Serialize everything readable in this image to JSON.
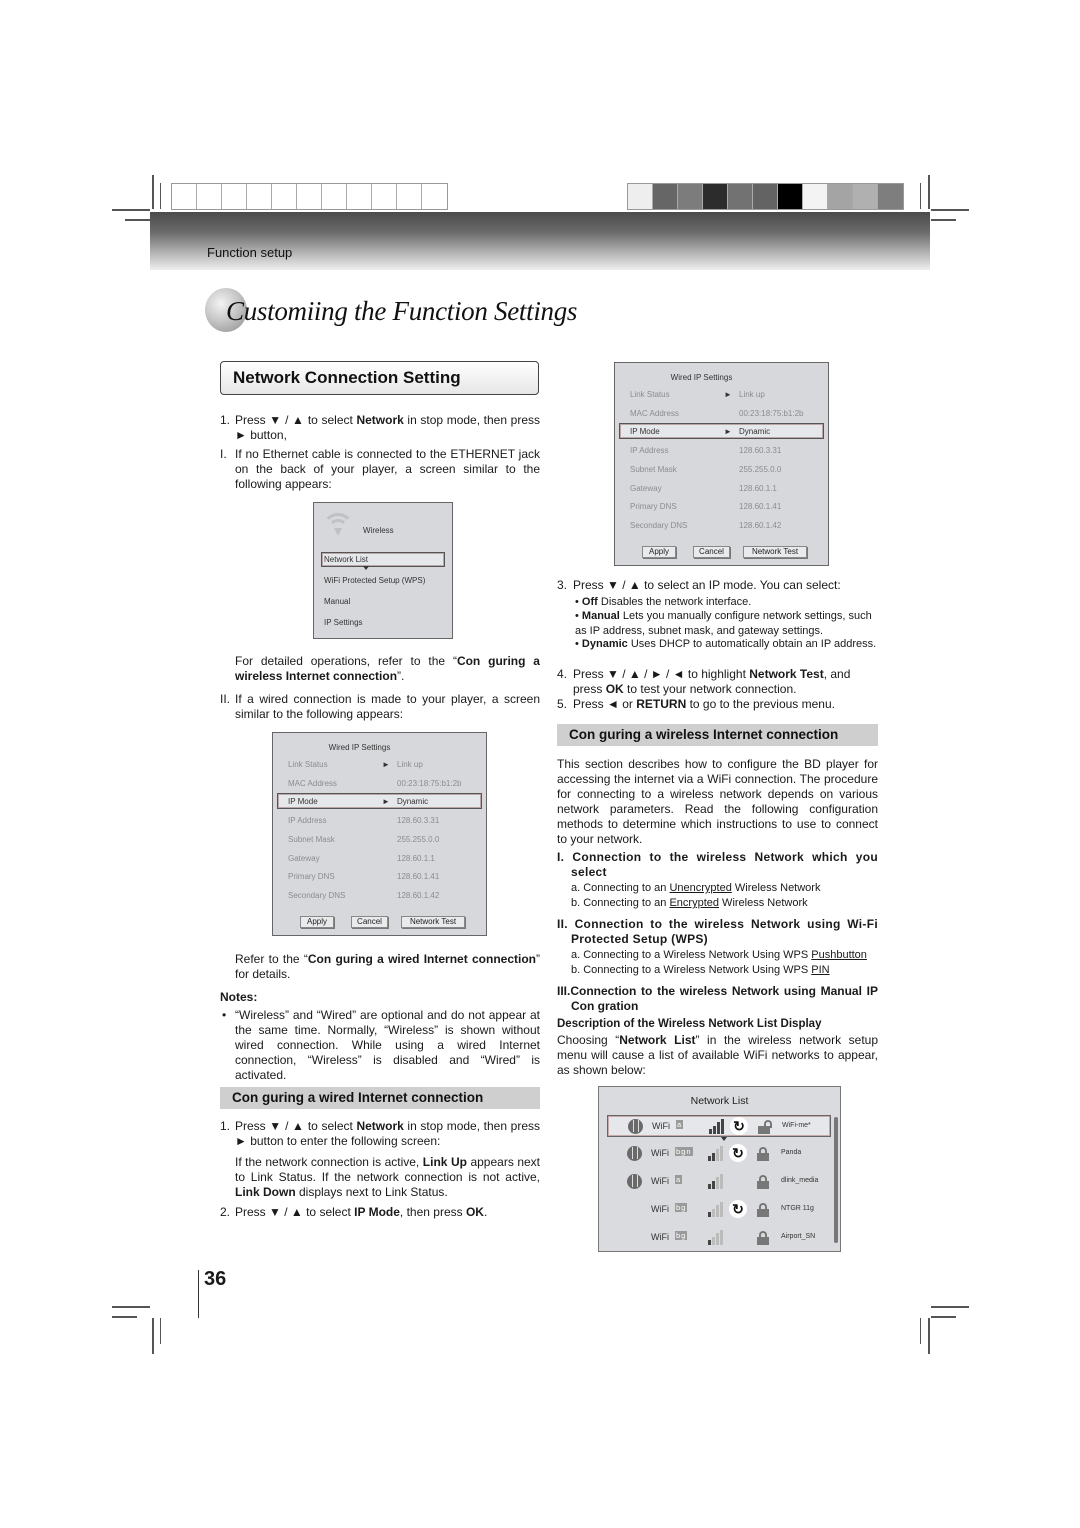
{
  "header": {
    "section_label": "Function setup",
    "page_title": "Customiing the Function Settings",
    "color_swatches": [
      "#eeeeee",
      "#666666",
      "#7c7c7c",
      "#2c2c2c",
      "#727272",
      "#636363",
      "#000000",
      "#f3f3f3",
      "#a4a4a4",
      "#b0b0b0",
      "#7e7e7e"
    ]
  },
  "left": {
    "section_title": "Network Connection Setting",
    "step1_num": "1.",
    "step1_pre": "Press ▼ / ▲ to select ",
    "step1_bold": "Network",
    "step1_post": " in stop mode, then press ► button,",
    "stepI_num": "I.",
    "stepI_text": "If no Ethernet cable is connected to the ETHERNET jack on the back of your player, a screen similar to the following appears:",
    "wireless_screen": {
      "title": "Wireless",
      "items": [
        "Network List",
        "WiFi Protected Setup (WPS)",
        "Manual",
        "IP Settings"
      ],
      "selected": "Network List"
    },
    "refer_wireless_pre": "For detailed operations, refer to the “",
    "refer_wireless_bold": "Con  guring a wireless Internet connection",
    "refer_wireless_post": "”.",
    "stepII_num": "II.",
    "stepII_text": "If a wired connection is made to your player, a screen similar to the following appears:",
    "refer_wired_pre": "Refer to the “",
    "refer_wired_bold": "Con   guring a wired Internet connection",
    "refer_wired_post": "” for details.",
    "notes_title": "Notes:",
    "notes_bullet": "•",
    "notes_text": "“Wireless” and “Wired” are optional and do not appear at the same time. Normally, “Wireless” is shown without wired connection. While using a wired Internet connection, “Wireless” is disabled and “Wired” is activated.",
    "wired_heading": "Con  guring a wired Internet connection",
    "w1_num": "1.",
    "w1_pre": "Press ▼ / ▲ to select ",
    "w1_bold": "Network",
    "w1_post": " in stop mode, then press ► button to enter the following screen:",
    "w1_para_pre": "If the network connection is active, ",
    "w1_para_b1": "Link Up",
    "w1_para_mid": " appears next to Link Status. If the network connection is not active, ",
    "w1_para_b2": "Link Down",
    "w1_para_post": " displays next to Link Status.",
    "w2_num": "2.",
    "w2_pre": "Press ▼ / ▲ to select ",
    "w2_bold": "IP Mode",
    "w2_mid": ", then press ",
    "w2_bold2": "OK",
    "w2_post": "."
  },
  "wired_screen": {
    "title": "Wired IP Settings",
    "rows": [
      {
        "label": "Link Status",
        "arrow": "►",
        "value": "Link up",
        "highlight": false
      },
      {
        "label": "MAC Address",
        "arrow": "",
        "value": "00:23:18:75:b1:2b",
        "highlight": false
      },
      {
        "label": "IP Mode",
        "arrow": "►",
        "value": "Dynamic",
        "highlight": true
      },
      {
        "label": "IP Address",
        "arrow": "",
        "value": "128.60.3.31",
        "highlight": false
      },
      {
        "label": "Subnet Mask",
        "arrow": "",
        "value": "255.255.0.0",
        "highlight": false
      },
      {
        "label": "Gateway",
        "arrow": "",
        "value": "128.60.1.1",
        "highlight": false
      },
      {
        "label": "Primary DNS",
        "arrow": "",
        "value": "128.60.1.41",
        "highlight": false
      },
      {
        "label": "Secondary DNS",
        "arrow": "",
        "value": "128.60.1.42",
        "highlight": false
      }
    ],
    "buttons": {
      "apply": "Apply",
      "cancel": "Cancel",
      "network_test": "Network Test"
    }
  },
  "right": {
    "s3_num": "3.",
    "s3_text": "Press ▼ / ▲ to select an IP mode. You can select:",
    "options": [
      {
        "bold": "Off",
        "text": "  Disables the network interface."
      },
      {
        "bold": "Manual",
        "text": "  Lets you manually configure network settings, such as IP address, subnet mask, and gateway settings."
      },
      {
        "bold": "Dynamic",
        "text": "  Uses DHCP to automatically obtain an IP address."
      }
    ],
    "s4_num": "4.",
    "s4_pre": "Press ▼ / ▲ / ► / ◄ to highlight ",
    "s4_bold": "Network Test",
    "s4_mid": ", and press ",
    "s4_bold2": "OK",
    "s4_post": " to test your network connection.",
    "s5_num": "5.",
    "s5_pre": "Press ◄ or ",
    "s5_bold": "RETURN",
    "s5_post": " to go to the previous menu.",
    "wireless_heading": "Con  guring a wireless Internet connection",
    "intro": "This section describes how to configure the BD player for accessing the internet via a WiFi connection. The procedure for connecting to a wireless network depends on various network parameters. Read the following configuration methods to determine which instructions to use to connect to your network.",
    "m1_title": "I.  Connection to the wireless Network which you select",
    "m1_a_pre": "a. Connecting to an ",
    "m1_a_u": "Unencrypted",
    "m1_a_post": " Wireless Network",
    "m1_b_pre": "b. Connecting to an ",
    "m1_b_u": "Encrypted",
    "m1_b_post": " Wireless Network",
    "m2_title": "II. Connection to the wireless Network using Wi-Fi Protected Setup (WPS)",
    "m2_a_pre": "a. Connecting to a Wireless Network Using WPS ",
    "m2_a_u": "Pushbutton",
    "m2_b_pre": "b. Connecting to a Wireless Network Using WPS ",
    "m2_b_u": "PIN",
    "m3_title": "III.Connection to the wireless Network using Manual IP Con  gration",
    "desc_title": "Description of the Wireless Network List Display",
    "desc_pre": "Choosing “",
    "desc_bold": "Network List",
    "desc_post": "” in the wireless network setup menu will cause a list of available WiFi networks to appear, as shown below:"
  },
  "network_list": {
    "title": "Network List",
    "rows": [
      {
        "connected_icon": true,
        "label": "WiFi",
        "badge": "a",
        "signal_bars": 4,
        "signal_max": 4,
        "wps": true,
        "lock": "unlocked",
        "ssid": "WiFi-me*",
        "selected": true
      },
      {
        "connected_icon": true,
        "label": "WiFi",
        "badge": "bgn",
        "signal_bars": 2,
        "signal_max": 4,
        "wps": true,
        "lock": "locked",
        "ssid": "Panda",
        "selected": false
      },
      {
        "connected_icon": true,
        "label": "WiFi",
        "badge": "a",
        "signal_bars": 2,
        "signal_max": 4,
        "wps": false,
        "lock": "locked",
        "ssid": "dlink_media",
        "selected": false
      },
      {
        "connected_icon": false,
        "label": "WiFi",
        "badge": "bg",
        "signal_bars": 1,
        "signal_max": 4,
        "wps": true,
        "lock": "locked",
        "ssid": "NTGR 11g",
        "selected": false
      },
      {
        "connected_icon": false,
        "label": "WiFi",
        "badge": "bg",
        "signal_bars": 1,
        "signal_max": 4,
        "wps": false,
        "lock": "locked",
        "ssid": "Airport_SN",
        "selected": false
      }
    ]
  },
  "footer": {
    "page_number": "36"
  }
}
